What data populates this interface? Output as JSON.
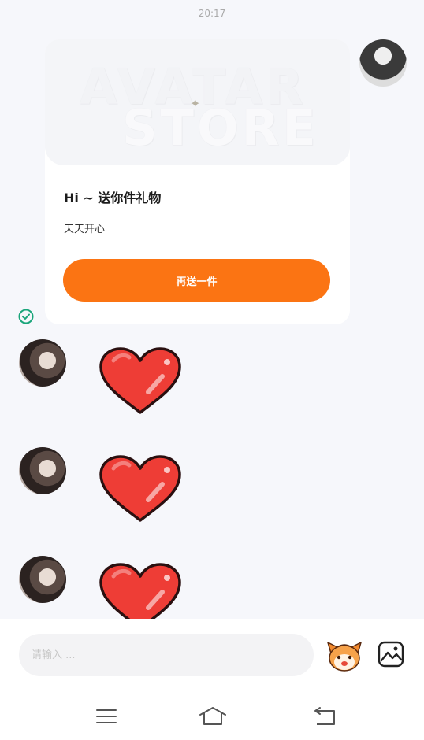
{
  "status": {
    "time": "20:17"
  },
  "gift_card": {
    "banner_line1": "AVATAR",
    "banner_line2": "STORE",
    "title": "Hi ~ 送你件礼物",
    "subtitle": "天天开心",
    "button_label": "再送一件"
  },
  "messages": [
    {
      "type": "sticker",
      "sticker": "red-heart"
    },
    {
      "type": "sticker",
      "sticker": "red-heart"
    },
    {
      "type": "sticker",
      "sticker": "red-heart"
    }
  ],
  "composer": {
    "placeholder": "请输入 ...",
    "emoji_icon": "mascot-face-icon",
    "image_icon": "image-icon"
  },
  "nav": {
    "menu_icon": "menu-icon",
    "home_icon": "home-icon",
    "back_icon": "back-icon"
  },
  "colors": {
    "accent": "#fb7413",
    "check": "#1aa57a",
    "heart": "#ee3d36",
    "background": "#f6f7fb"
  }
}
